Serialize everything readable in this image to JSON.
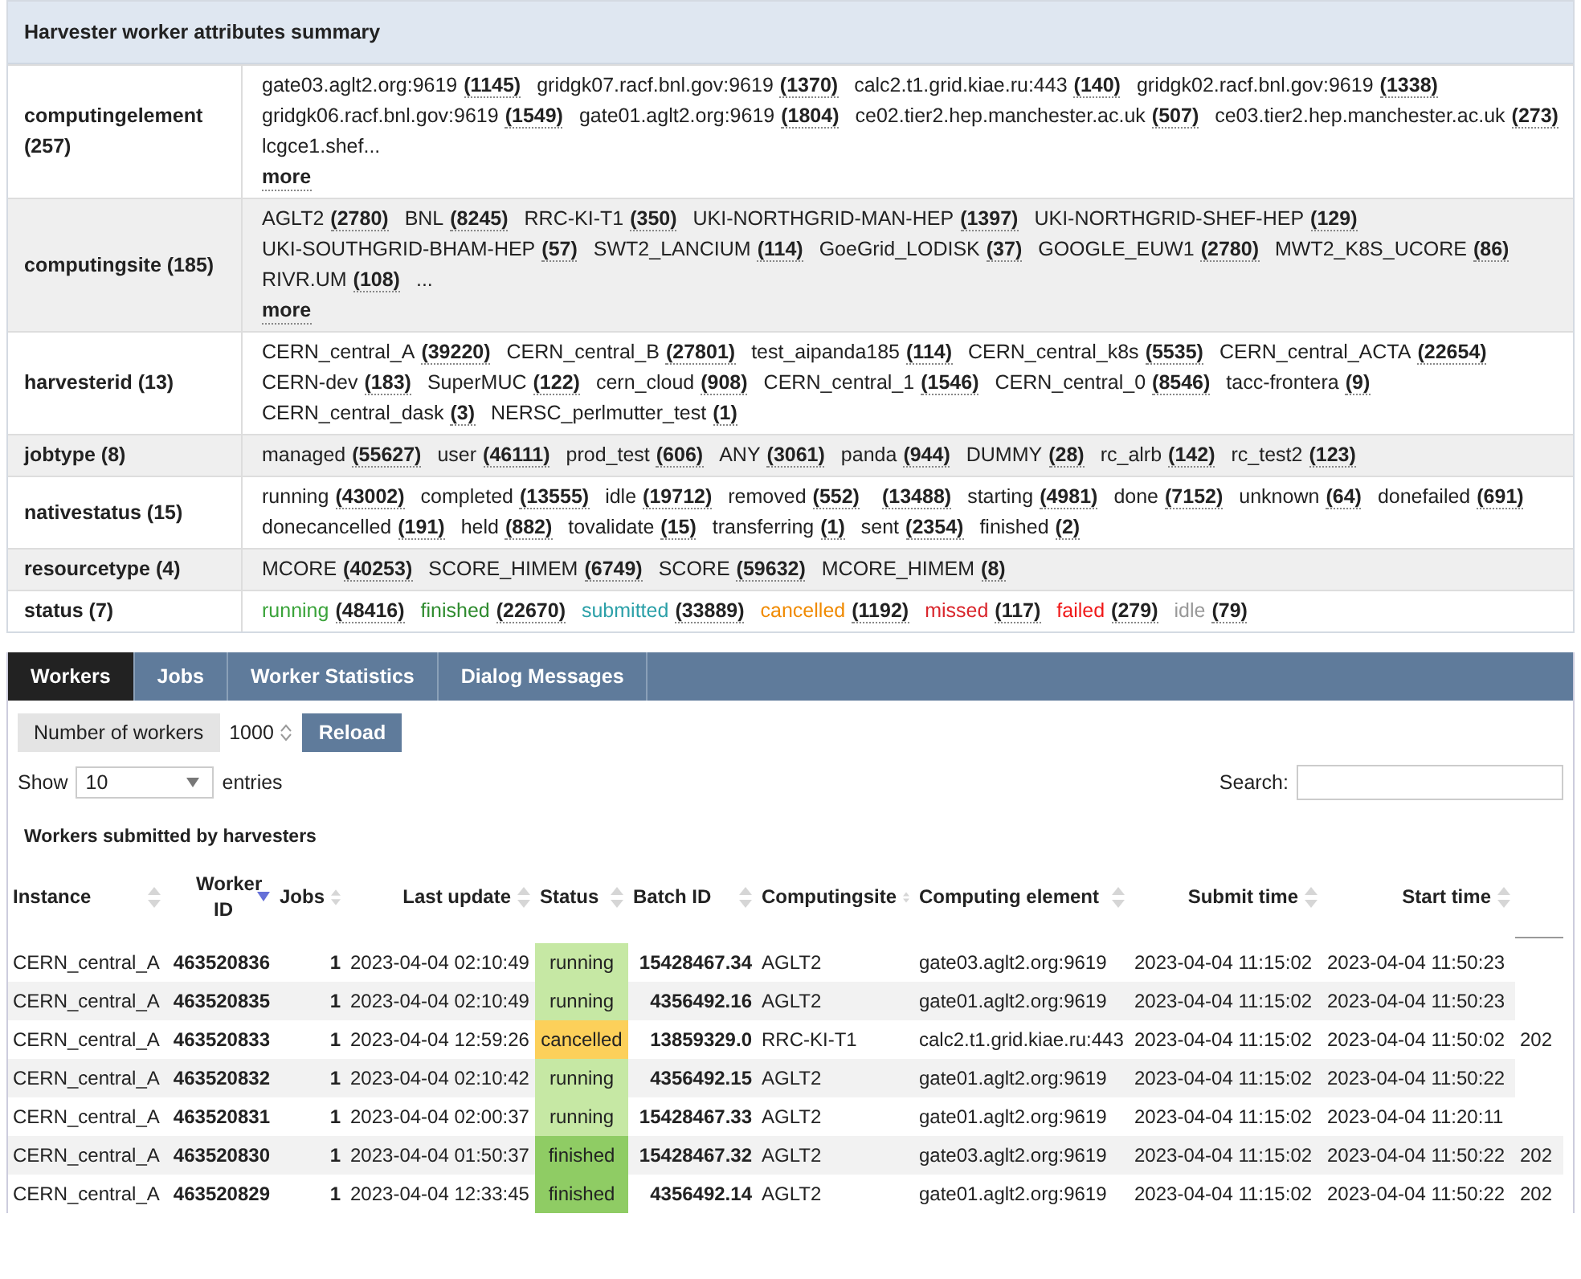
{
  "summary": {
    "title": "Harvester worker attributes summary",
    "attributes": [
      {
        "name": "computingelement (257)",
        "items": [
          {
            "label": "gate03.aglt2.org:9619",
            "count": "(1145)"
          },
          {
            "label": "gridgk07.racf.bnl.gov:9619",
            "count": "(1370)"
          },
          {
            "label": "calc2.t1.grid.kiae.ru:443",
            "count": "(140)"
          },
          {
            "label": "gridgk02.racf.bnl.gov:9619",
            "count": "(1338)"
          },
          {
            "label": "gridgk06.racf.bnl.gov:9619",
            "count": "(1549)"
          },
          {
            "label": "gate01.aglt2.org:9619",
            "count": "(1804)"
          },
          {
            "label": "ce02.tier2.hep.manchester.ac.uk",
            "count": "(507)"
          },
          {
            "label": "ce03.tier2.hep.manchester.ac.uk",
            "count": "(273)"
          },
          {
            "label": "lcgce1.shef..."
          }
        ],
        "more": "more"
      },
      {
        "name": "computingsite (185)",
        "items": [
          {
            "label": "AGLT2",
            "count": "(2780)"
          },
          {
            "label": "BNL",
            "count": "(8245)"
          },
          {
            "label": "RRC-KI-T1",
            "count": "(350)"
          },
          {
            "label": "UKI-NORTHGRID-MAN-HEP",
            "count": "(1397)"
          },
          {
            "label": "UKI-NORTHGRID-SHEF-HEP",
            "count": "(129)"
          },
          {
            "label": "UKI-SOUTHGRID-BHAM-HEP",
            "count": "(57)"
          },
          {
            "label": "SWT2_LANCIUM",
            "count": "(114)"
          },
          {
            "label": "GoeGrid_LODISK",
            "count": "(37)"
          },
          {
            "label": "GOOGLE_EUW1",
            "count": "(2780)"
          },
          {
            "label": "MWT2_K8S_UCORE",
            "count": "(86)"
          },
          {
            "label": "RIVR.UM",
            "count": "(108)"
          },
          {
            "label": "..."
          }
        ],
        "more": "more"
      },
      {
        "name": "harvesterid (13)",
        "items": [
          {
            "label": "CERN_central_A",
            "count": "(39220)"
          },
          {
            "label": "CERN_central_B",
            "count": "(27801)"
          },
          {
            "label": "test_aipanda185",
            "count": "(114)"
          },
          {
            "label": "CERN_central_k8s",
            "count": "(5535)"
          },
          {
            "label": "CERN_central_ACTA",
            "count": "(22654)"
          },
          {
            "label": "CERN-dev",
            "count": "(183)"
          },
          {
            "label": "SuperMUC",
            "count": "(122)"
          },
          {
            "label": "cern_cloud",
            "count": "(908)"
          },
          {
            "label": "CERN_central_1",
            "count": "(1546)"
          },
          {
            "label": "CERN_central_0",
            "count": "(8546)"
          },
          {
            "label": "tacc-frontera",
            "count": "(9)"
          },
          {
            "label": "CERN_central_dask",
            "count": "(3)"
          },
          {
            "label": "NERSC_perlmutter_test",
            "count": "(1)"
          }
        ]
      },
      {
        "name": "jobtype (8)",
        "items": [
          {
            "label": "managed",
            "count": "(55627)"
          },
          {
            "label": "user",
            "count": "(46111)"
          },
          {
            "label": "prod_test",
            "count": "(606)"
          },
          {
            "label": "ANY",
            "count": "(3061)"
          },
          {
            "label": "panda",
            "count": "(944)"
          },
          {
            "label": "DUMMY",
            "count": "(28)"
          },
          {
            "label": "rc_alrb",
            "count": "(142)"
          },
          {
            "label": "rc_test2",
            "count": "(123)"
          }
        ]
      },
      {
        "name": "nativestatus (15)",
        "items": [
          {
            "label": "running",
            "count": "(43002)"
          },
          {
            "label": "completed",
            "count": "(13555)"
          },
          {
            "label": "idle",
            "count": "(19712)"
          },
          {
            "label": "removed",
            "count": "(552)"
          },
          {
            "count": "(13488)"
          },
          {
            "label": "starting",
            "count": "(4981)"
          },
          {
            "label": "done",
            "count": "(7152)"
          },
          {
            "label": "unknown",
            "count": "(64)"
          },
          {
            "label": "donefailed",
            "count": "(691)"
          },
          {
            "label": "donecancelled",
            "count": "(191)"
          },
          {
            "label": "held",
            "count": "(882)"
          },
          {
            "label": "tovalidate",
            "count": "(15)"
          },
          {
            "label": "transferring",
            "count": "(1)"
          },
          {
            "label": "sent",
            "count": "(2354)"
          },
          {
            "label": "finished",
            "count": "(2)"
          }
        ]
      },
      {
        "name": "resourcetype (4)",
        "items": [
          {
            "label": "MCORE",
            "count": "(40253)"
          },
          {
            "label": "SCORE_HIMEM",
            "count": "(6749)"
          },
          {
            "label": "SCORE",
            "count": "(59632)"
          },
          {
            "label": "MCORE_HIMEM",
            "count": "(8)"
          }
        ]
      },
      {
        "name": "status (7)",
        "items": [
          {
            "label": "running",
            "count": "(48416)",
            "color": "#3aa33a"
          },
          {
            "label": "finished",
            "count": "(22670)",
            "color": "#2e8b2e"
          },
          {
            "label": "submitted",
            "count": "(33889)",
            "color": "#2ba0a8"
          },
          {
            "label": "cancelled",
            "count": "(1192)",
            "color": "#f08a00"
          },
          {
            "label": "missed",
            "count": "(117)",
            "color": "#d9262c"
          },
          {
            "label": "failed",
            "count": "(279)",
            "color": "#f01818"
          },
          {
            "label": "idle",
            "count": "(79)",
            "color": "#999999"
          }
        ]
      }
    ]
  },
  "tabs": [
    {
      "label": "Workers",
      "selected": true
    },
    {
      "label": "Jobs",
      "selected": false
    },
    {
      "label": "Worker Statistics",
      "selected": false
    },
    {
      "label": "Dialog Messages",
      "selected": false
    }
  ],
  "workers_control": {
    "label": "Number of workers",
    "value": "1000",
    "button": "Reload"
  },
  "length_control": {
    "before": "Show",
    "value": "10",
    "after": "entries"
  },
  "search": {
    "label": "Search:"
  },
  "table": {
    "caption": "Workers submitted by harvesters",
    "columns": [
      {
        "label": "Instance",
        "sorted": false
      },
      {
        "label": "Worker ID",
        "sorted": true
      },
      {
        "label": "Jobs",
        "sorted": false
      },
      {
        "label": "Last update",
        "sorted": false
      },
      {
        "label": "Status",
        "sorted": false
      },
      {
        "label": "Batch ID",
        "sorted": false
      },
      {
        "label": "Computingsite",
        "sorted": false
      },
      {
        "label": "Computing element",
        "sorted": false
      },
      {
        "label": "Submit time",
        "sorted": false
      },
      {
        "label": "Start time",
        "sorted": false
      }
    ],
    "rows": [
      {
        "cells": [
          "CERN_central_A",
          "463520836",
          "1",
          "2023-04-04 02:10:49",
          "running",
          "15428467.34",
          "AGLT2",
          "gate03.aglt2.org:9619",
          "2023-04-04 11:15:02",
          "2023-04-04 11:50:23"
        ],
        "color": "#c6e8a4"
      },
      {
        "cells": [
          "CERN_central_A",
          "463520835",
          "1",
          "2023-04-04 02:10:49",
          "running",
          "4356492.16",
          "AGLT2",
          "gate01.aglt2.org:9619",
          "2023-04-04 11:15:02",
          "2023-04-04 11:50:23"
        ],
        "color": "#c6e8a4"
      },
      {
        "cells": [
          "CERN_central_A",
          "463520833",
          "1",
          "2023-04-04 12:59:26",
          "cancelled",
          "13859329.0",
          "RRC-KI-T1",
          "calc2.t1.grid.kiae.ru:443",
          "2023-04-04 11:15:02",
          "2023-04-04 11:50:02",
          "202"
        ],
        "color": "#fcd05a"
      },
      {
        "cells": [
          "CERN_central_A",
          "463520832",
          "1",
          "2023-04-04 02:10:42",
          "running",
          "4356492.15",
          "AGLT2",
          "gate01.aglt2.org:9619",
          "2023-04-04 11:15:02",
          "2023-04-04 11:50:22"
        ],
        "color": "#c6e8a4"
      },
      {
        "cells": [
          "CERN_central_A",
          "463520831",
          "1",
          "2023-04-04 02:00:37",
          "running",
          "15428467.33",
          "AGLT2",
          "gate01.aglt2.org:9619",
          "2023-04-04 11:15:02",
          "2023-04-04 11:20:11"
        ],
        "color": "#c6e8a4"
      },
      {
        "cells": [
          "CERN_central_A",
          "463520830",
          "1",
          "2023-04-04 01:50:37",
          "finished",
          "15428467.32",
          "AGLT2",
          "gate03.aglt2.org:9619",
          "2023-04-04 11:15:02",
          "2023-04-04 11:50:22",
          "202"
        ],
        "color": "#8fcc64"
      },
      {
        "cells": [
          "CERN_central_A",
          "463520829",
          "1",
          "2023-04-04 12:33:45",
          "finished",
          "4356492.14",
          "AGLT2",
          "gate01.aglt2.org:9619",
          "2023-04-04 11:15:02",
          "2023-04-04 11:50:22",
          "202"
        ],
        "color": "#8fcc64"
      }
    ]
  }
}
